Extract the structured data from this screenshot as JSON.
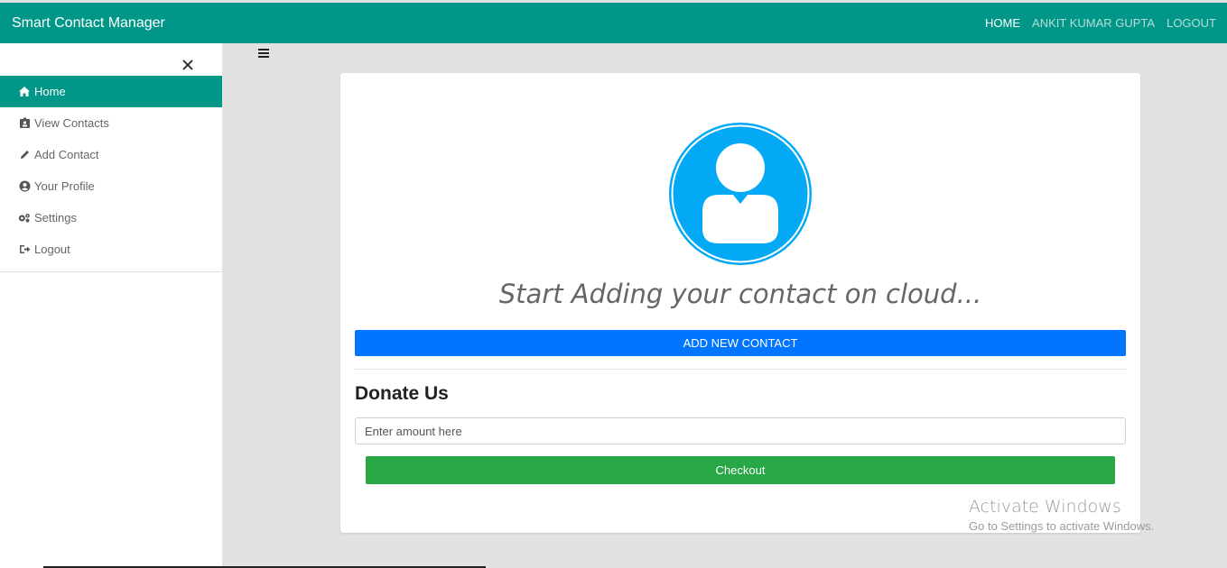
{
  "navbar": {
    "brand": "Smart Contact Manager",
    "links": [
      "HOME",
      "ANKIT KUMAR GUPTA",
      "LOGOUT"
    ]
  },
  "sidebar": {
    "items": [
      {
        "label": "Home",
        "icon": "home-icon",
        "active": true
      },
      {
        "label": "View Contacts",
        "icon": "id-card-icon"
      },
      {
        "label": "Add Contact",
        "icon": "pencil-icon"
      },
      {
        "label": "Your Profile",
        "icon": "user-circle-icon"
      },
      {
        "label": "Settings",
        "icon": "gears-icon"
      },
      {
        "label": "Logout",
        "icon": "sign-out-icon"
      }
    ]
  },
  "main": {
    "headline": "Start Adding your contact on cloud...",
    "add_button": "ADD NEW CONTACT",
    "donate_title": "Donate Us",
    "amount_placeholder": "Enter amount here",
    "checkout_button": "Checkout"
  },
  "watermark": {
    "title": "Activate Windows",
    "subtitle": "Go to Settings to activate Windows."
  },
  "colors": {
    "primary": "#009688",
    "add_button": "#0075ff",
    "checkout": "#28a745",
    "avatar": "#03a9f4"
  }
}
